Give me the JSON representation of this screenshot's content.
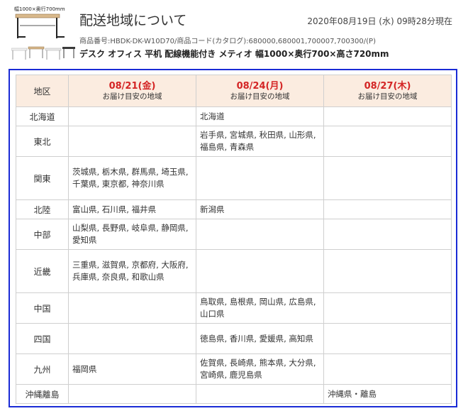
{
  "header": {
    "thumb_label": "幅1000×奥行700mm",
    "title": "配送地域について",
    "timestamp": "2020年08月19日 (水) 09時28分現在",
    "product_number": "商品番号:HBDK-DK-W10D70/商品コード(カタログ):680000,680001,700007,700300/(P)",
    "product_name": "デスク オフィス 平机 配線機能付き メティオ 幅1000×奥行700×高さ720mm"
  },
  "table": {
    "region_header": "地区",
    "columns": [
      {
        "date": "08/21(金)",
        "sub": "お届け目安の地域"
      },
      {
        "date": "08/24(月)",
        "sub": "お届け目安の地域"
      },
      {
        "date": "08/27(木)",
        "sub": "お届け目安の地域"
      }
    ],
    "rows": [
      {
        "region": "北海道",
        "c0": "",
        "c1": "北海道",
        "c2": ""
      },
      {
        "region": "東北",
        "c0": "",
        "c1": "岩手県, 宮城県, 秋田県, 山形県, 福島県, 青森県",
        "c2": ""
      },
      {
        "region": "関東",
        "c0": "茨城県, 栃木県, 群馬県, 埼玉県, 千葉県, 東京都, 神奈川県",
        "c1": "",
        "c2": ""
      },
      {
        "region": "北陸",
        "c0": "富山県, 石川県, 福井県",
        "c1": "新潟県",
        "c2": ""
      },
      {
        "region": "中部",
        "c0": "山梨県, 長野県, 岐阜県, 静岡県, 愛知県",
        "c1": "",
        "c2": ""
      },
      {
        "region": "近畿",
        "c0": "三重県, 滋賀県, 京都府, 大阪府, 兵庫県, 奈良県, 和歌山県",
        "c1": "",
        "c2": ""
      },
      {
        "region": "中国",
        "c0": "",
        "c1": "鳥取県, 島根県, 岡山県, 広島県, 山口県",
        "c2": ""
      },
      {
        "region": "四国",
        "c0": "",
        "c1": "徳島県, 香川県, 愛媛県, 高知県",
        "c2": ""
      },
      {
        "region": "九州",
        "c0": "福岡県",
        "c1": "佐賀県, 長崎県, 熊本県, 大分県, 宮崎県, 鹿児島県",
        "c2": ""
      },
      {
        "region": "沖縄離島",
        "c0": "",
        "c1": "",
        "c2": "沖縄県・離島"
      }
    ]
  },
  "colors": {
    "accent_date": "#d42525",
    "header_bg": "#fbece0",
    "frame_border": "#1a2bd6"
  }
}
